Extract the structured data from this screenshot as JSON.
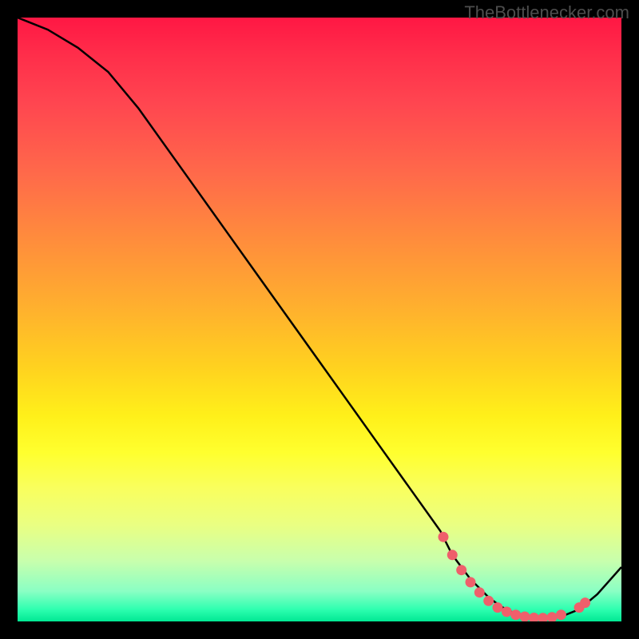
{
  "attribution": "TheBottlenecker.com",
  "chart_data": {
    "type": "line",
    "title": "",
    "xlabel": "",
    "ylabel": "",
    "xlim": [
      0,
      100
    ],
    "ylim": [
      0,
      100
    ],
    "series": [
      {
        "name": "curve",
        "x": [
          0,
          5,
          10,
          15,
          20,
          25,
          30,
          35,
          40,
          45,
          50,
          55,
          60,
          65,
          70,
          72,
          75,
          78,
          80,
          82,
          85,
          88,
          90,
          93,
          96,
          100
        ],
        "y": [
          100,
          98,
          95,
          91,
          85,
          78,
          71,
          64,
          57,
          50,
          43,
          36,
          29,
          22,
          15,
          11,
          7,
          4,
          2.5,
          1.5,
          0.8,
          0.5,
          0.8,
          2,
          4.5,
          9
        ]
      }
    ],
    "markers": [
      {
        "x": 70.5,
        "y": 14
      },
      {
        "x": 72,
        "y": 11
      },
      {
        "x": 73.5,
        "y": 8.5
      },
      {
        "x": 75,
        "y": 6.5
      },
      {
        "x": 76.5,
        "y": 4.8
      },
      {
        "x": 78,
        "y": 3.4
      },
      {
        "x": 79.5,
        "y": 2.3
      },
      {
        "x": 81,
        "y": 1.6
      },
      {
        "x": 82.5,
        "y": 1.1
      },
      {
        "x": 84,
        "y": 0.8
      },
      {
        "x": 85.5,
        "y": 0.6
      },
      {
        "x": 87,
        "y": 0.55
      },
      {
        "x": 88.5,
        "y": 0.7
      },
      {
        "x": 90,
        "y": 1.1
      },
      {
        "x": 93,
        "y": 2.3
      },
      {
        "x": 94,
        "y": 3.1
      }
    ],
    "marker_color": "#ef5f6b",
    "line_color": "#000000"
  }
}
